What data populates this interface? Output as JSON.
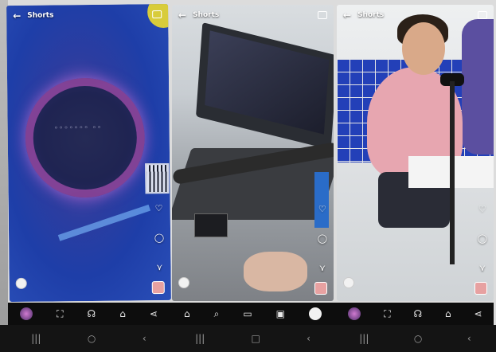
{
  "app": {
    "accent": "#e7a1a1",
    "overlay_text_color": "#ffffff",
    "nav_background": "#0d0d0d"
  },
  "panels": [
    {
      "title": "Shorts",
      "icons": {
        "back": "back-arrow-icon",
        "camera": "camera-icon"
      },
      "rail": [
        "like-icon",
        "comment-icon",
        "remix-icon"
      ],
      "username": "",
      "caption": "",
      "subcaption": "",
      "music": "",
      "nav": [
        "album-icon",
        "expand-icon",
        "headphones-icon",
        "home-icon",
        "share-icon"
      ]
    },
    {
      "title": "Shorts",
      "icons": {
        "back": "back-arrow-icon",
        "camera": "camera-icon"
      },
      "rail": [
        "like-icon",
        "comment-icon",
        "remix-icon"
      ],
      "username": "",
      "caption": "",
      "subcaption": "",
      "music": "",
      "nav": [
        "home-icon",
        "search-icon",
        "subscriptions-icon",
        "library-icon",
        "profile-icon"
      ]
    },
    {
      "title": "Shorts",
      "icons": {
        "back": "back-arrow-icon",
        "camera": "camera-icon"
      },
      "rail": [
        "like-icon",
        "comment-icon",
        "remix-icon"
      ],
      "username": "",
      "caption": "",
      "subcaption": "",
      "music": "",
      "nav": [
        "album-icon",
        "expand-icon",
        "headphones-icon",
        "home-icon",
        "share-icon"
      ]
    }
  ],
  "system_nav": [
    "recents-icon",
    "home-circle-icon",
    "back-chevron-icon"
  ]
}
